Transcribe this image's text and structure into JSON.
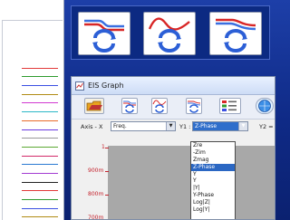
{
  "bg_window": {
    "legend_colors": [
      "#e23a3a",
      "#2e9b2e",
      "#3a4fe2",
      "#b08b14",
      "#d23ad2",
      "#2bb7c7",
      "#e86b2a",
      "#6a3adf",
      "#999999",
      "#5aa832",
      "#d22a6a",
      "#2a7ad2",
      "#a23ad2",
      "#222222",
      "#e23a3a",
      "#2e9b2e",
      "#3a4fe2",
      "#b08b14"
    ]
  },
  "icon_strip": {
    "icons": [
      "bode-icon",
      "sine-wave-icon",
      "nyquist-icon"
    ]
  },
  "window": {
    "title": "EIS Graph"
  },
  "axis": {
    "x_label": "Axis - X",
    "x_value": "Freq.",
    "y1_label": "Y1 :",
    "y1_value": "Z-Phase",
    "y2_label": "Y2 ="
  },
  "dropdown": {
    "options": [
      "Zre",
      "-Zim",
      "Zmag",
      "Z-Phase",
      "Y",
      "Y",
      "|Y|",
      "Y-Phase",
      "Log|Z|",
      "Log|Y|"
    ],
    "selected_index": 3
  },
  "plot": {
    "y_ticks": [
      "1",
      "900m",
      "800m",
      "700m"
    ],
    "colors": {
      "tick": "#c4232d",
      "background": "#a8a8a8"
    }
  }
}
